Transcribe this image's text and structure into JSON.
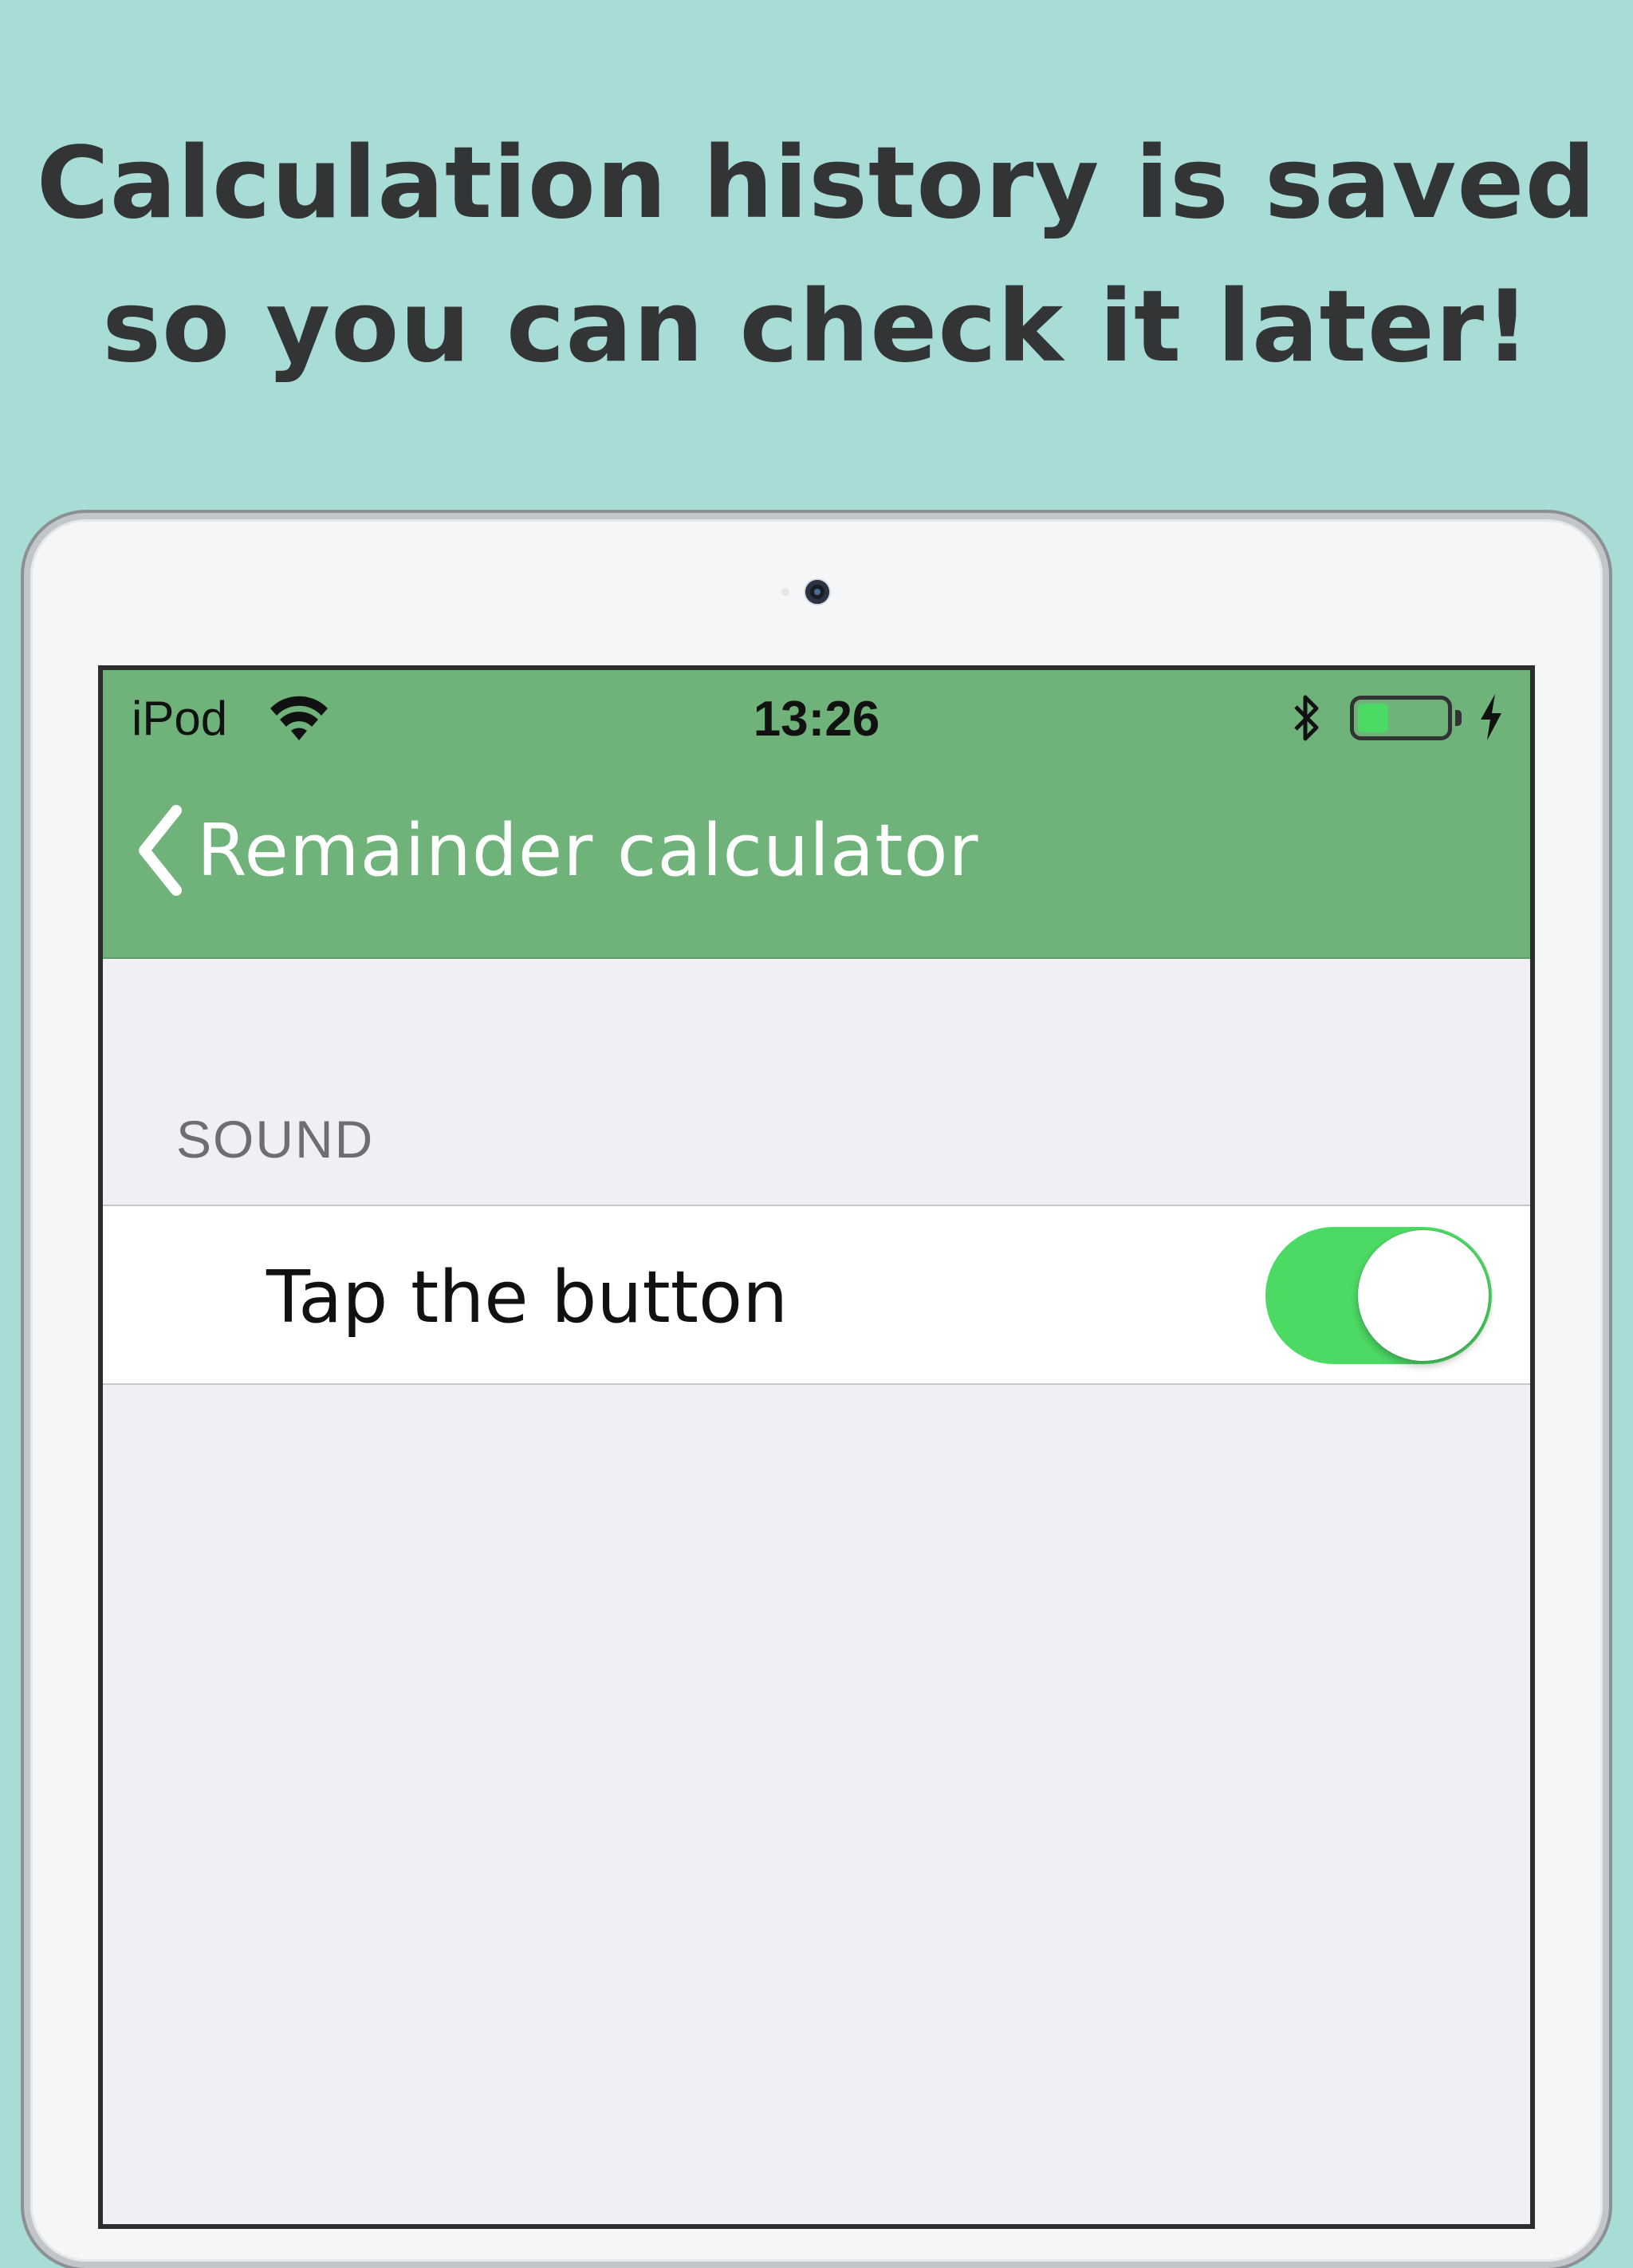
{
  "headline": {
    "line1": "Calculation history is saved",
    "line2": "so you can check it later!"
  },
  "statusbar": {
    "carrier": "iPod",
    "time": "13:26",
    "battery_level": 0.35,
    "icons": [
      "wifi-icon",
      "bluetooth-icon",
      "battery-icon",
      "charging-bolt-icon"
    ]
  },
  "navbar": {
    "back_label": "Remainder calculator",
    "back_icon": "chevron-left-icon"
  },
  "settings": {
    "section_header": "SOUND",
    "rows": [
      {
        "label": "Tap the button",
        "toggle_on": true
      }
    ]
  },
  "colors": {
    "background": "#a8dcd7",
    "nav_green": "#6fb37a",
    "toggle_green": "#4cd964",
    "headline_text": "#333435"
  }
}
